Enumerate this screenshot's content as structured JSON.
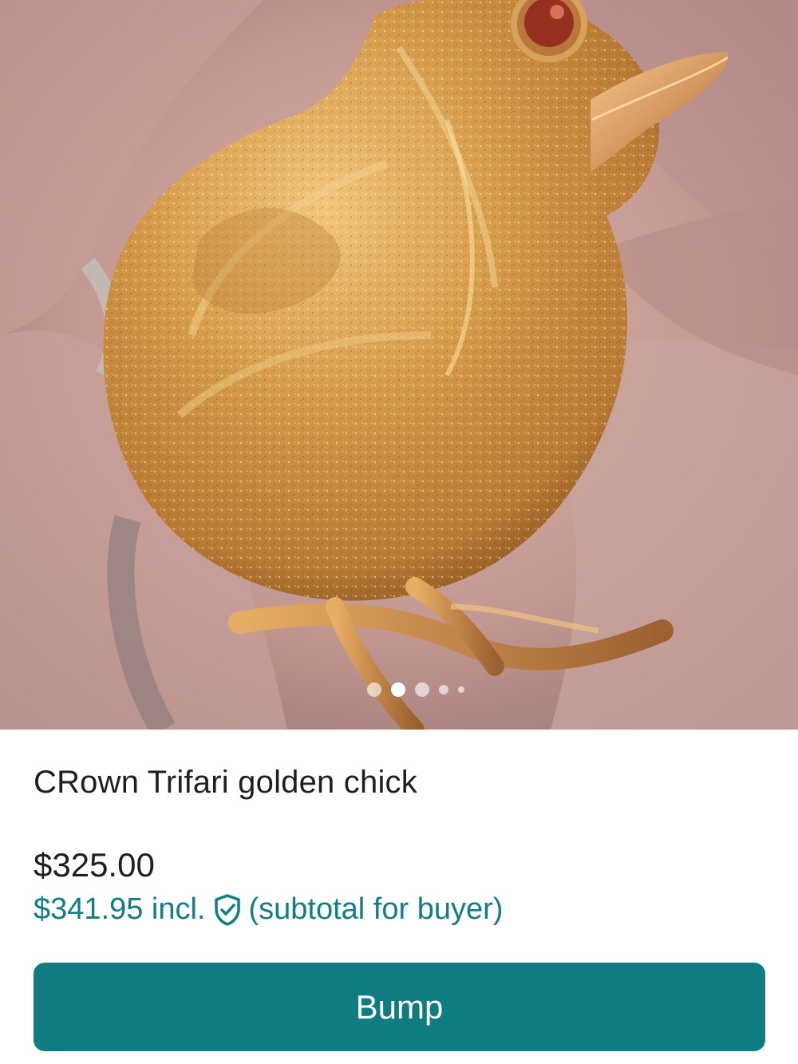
{
  "listing": {
    "image_alt": "Golden textured bird brooch with red eye held in fingers",
    "carousel": {
      "current": 2,
      "total": 5
    },
    "title": "CRown Trifari golden chick",
    "price": "$325.00",
    "buyer_price": "$341.95 incl.",
    "buyer_note": "(subtotal for buyer)",
    "protection_icon": "shield-check-icon"
  },
  "actions": {
    "bump_label": "Bump"
  },
  "colors": {
    "accent": "#0f7c81",
    "buyer_text": "#127d83",
    "title_text": "#1f1f1f"
  }
}
